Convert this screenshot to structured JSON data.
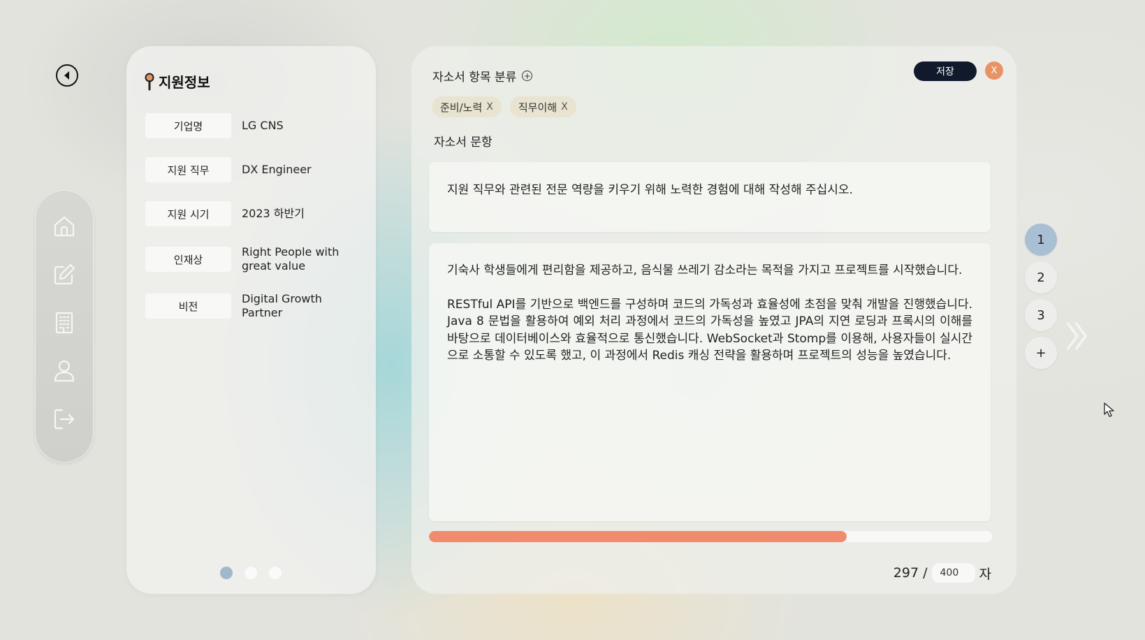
{
  "back": {
    "icon": "back-arrow-icon"
  },
  "sidebar": {
    "items": [
      {
        "name": "home",
        "icon": "home-icon"
      },
      {
        "name": "edit",
        "icon": "edit-icon"
      },
      {
        "name": "building",
        "icon": "building-icon"
      },
      {
        "name": "profile",
        "icon": "user-icon"
      },
      {
        "name": "logout",
        "icon": "logout-icon"
      }
    ]
  },
  "info": {
    "title": "지원정보",
    "rows": [
      {
        "label": "기업명",
        "value": "LG CNS"
      },
      {
        "label": "지원 직무",
        "value": "DX Engineer"
      },
      {
        "label": "지원 시기",
        "value": "2023 하반기"
      },
      {
        "label": "인재상",
        "value": "Right People with great value"
      },
      {
        "label": "비전",
        "value": "Digital Growth Partner"
      }
    ],
    "carousel": {
      "count": 3,
      "active": 0
    }
  },
  "editor": {
    "category_title": "자소서 항목 분류",
    "save_label": "저장",
    "close_label": "X",
    "tags": [
      {
        "label": "준비/노력",
        "remove": "X"
      },
      {
        "label": "직무이해",
        "remove": "X"
      }
    ],
    "question_label": "자소서 문항",
    "question": "지원 직무와 관련된 전문 역량을 키우기 위해 노력한 경험에 대해 작성해 주십시오.",
    "answer_paragraphs": [
      "기숙사 학생들에게 편리함을 제공하고, 음식물 쓰레기 감소라는 목적을 가지고 프로젝트를 시작했습니다.",
      "RESTful API를 기반으로 백엔드를 구성하며 코드의 가독성과 효율성에 초점을 맞춰 개발을 진행했습니다. Java 8 문법을 활용하여 예외 처리 과정에서 코드의 가독성을 높였고 JPA의 지연 로딩과 프록시의 이해를 바탕으로 데이터베이스와 효율적으로 통신했습니다. WebSocket과 Stomp를 이용해, 사용자들이 실시간으로 소통할 수 있도록 했고, 이 과정에서 Redis 캐싱 전략을 활용하며 프로젝트의 성능을 높였습니다."
    ],
    "char_count": "297 /",
    "char_limit": "400",
    "char_unit": "자",
    "progress": 0.7425,
    "progress_color": "#f18b6e"
  },
  "pages": {
    "items": [
      "1",
      "2",
      "3",
      "+"
    ],
    "active": 0
  },
  "colors": {
    "save_bg": "#101a2c",
    "close_bg": "#e99364",
    "active_page": "#a9bfd4",
    "active_dot": "#9fb8cc"
  }
}
